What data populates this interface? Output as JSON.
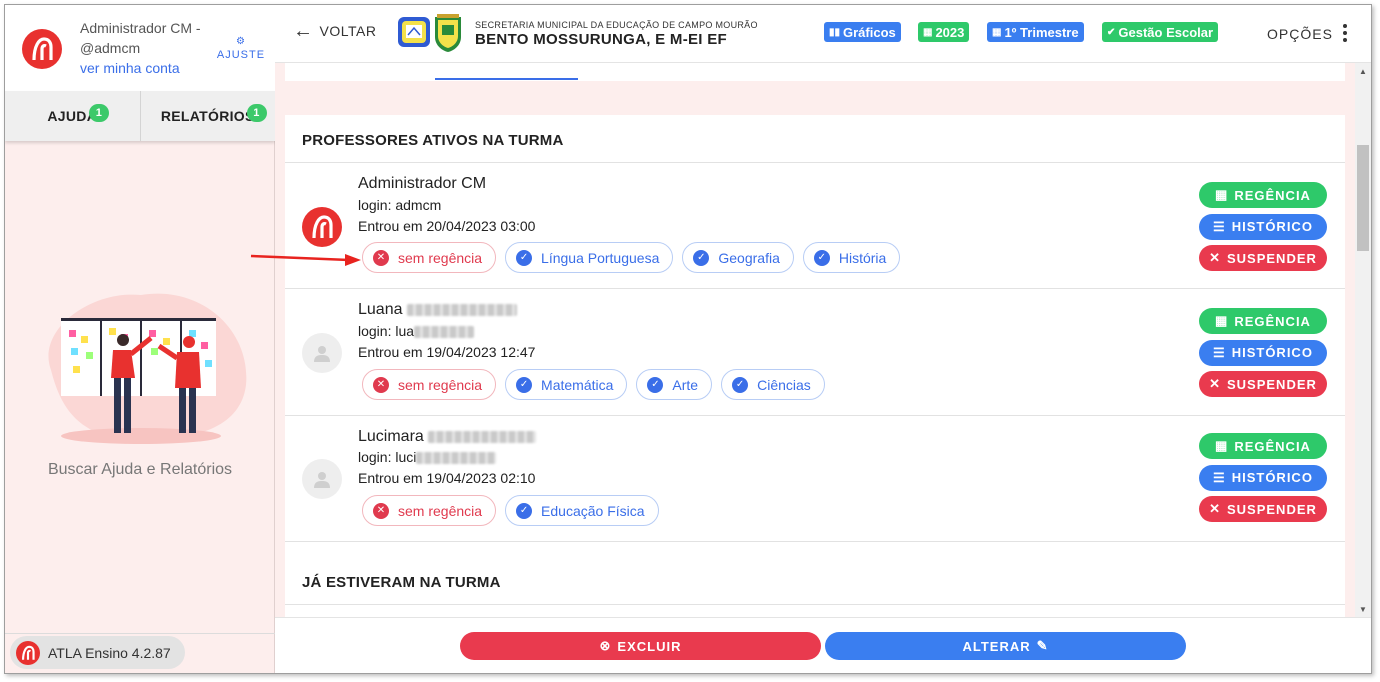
{
  "sidebar": {
    "user_name": "Administrador CM - @admcm",
    "account_link": "ver minha conta",
    "ajuste_label": "AJUSTE",
    "tabs": [
      {
        "label": "AJUDA",
        "badge": "1"
      },
      {
        "label": "RELATÓRIOS",
        "badge": "1"
      }
    ],
    "help_text": "Buscar Ajuda e Relatórios",
    "version": "ATLA Ensino 4.2.87"
  },
  "header": {
    "back_label": "VOLTAR",
    "school_subtitle": "SECRETARIA MUNICIPAL DA EDUCAÇÃO DE CAMPO MOURÃO",
    "school_name": "BENTO MOSSURUNGA, E M-EI EF",
    "chips": [
      {
        "label": "Gráficos",
        "icon": "bar-chart-icon",
        "color": "#3a7ef0"
      },
      {
        "label": "2023",
        "icon": "calendar-icon",
        "color": "#2ec96a"
      },
      {
        "label": "1º Trimestre",
        "icon": "calendar-icon",
        "color": "#3a7ef0"
      },
      {
        "label": "Gestão Escolar",
        "icon": "check-circle-icon",
        "color": "#2ec96a"
      }
    ],
    "options_label": "OPÇÕES"
  },
  "main": {
    "active_title": "PROFESSORES ATIVOS NA TURMA",
    "former_title": "JÁ ESTIVERAM NA TURMA",
    "teachers": [
      {
        "name": "Administrador CM",
        "login": "login: admcm",
        "entry": "Entrou em 20/04/2023 03:00",
        "regencia": "sem regência",
        "subjects": [
          "Língua Portuguesa",
          "Geografia",
          "História"
        ]
      },
      {
        "name": "Luana",
        "login": "login: lua",
        "entry": "Entrou em 19/04/2023 12:47",
        "regencia": "sem regência",
        "subjects": [
          "Matemática",
          "Arte",
          "Ciências"
        ]
      },
      {
        "name": "Lucimara",
        "login": "login: luci",
        "entry": "Entrou em 19/04/2023 02:10",
        "regencia": "sem regência",
        "subjects": [
          "Educação Física"
        ]
      }
    ],
    "actions": {
      "regencia": "REGÊNCIA",
      "historico": "HISTÓRICO",
      "suspender": "SUSPENDER"
    }
  },
  "footer": {
    "delete_label": "EXCLUIR",
    "update_label": "ALTERAR"
  },
  "colors": {
    "brand_red": "#e8312f",
    "primary_blue": "#3a7ef0",
    "success_green": "#2ec96a",
    "danger_red": "#e93a4e"
  }
}
